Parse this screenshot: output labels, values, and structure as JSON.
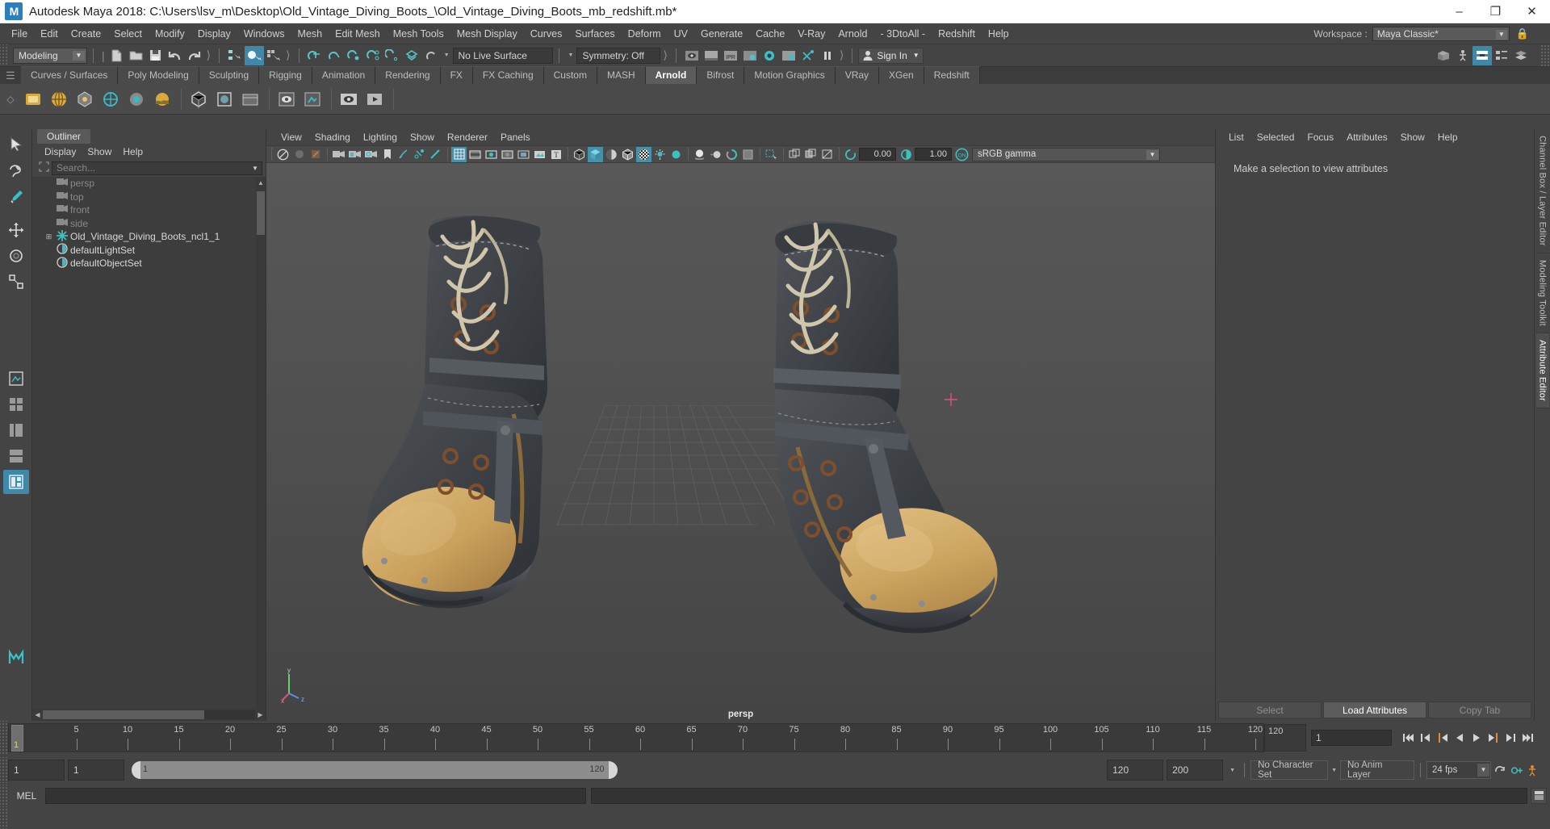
{
  "window": {
    "app_title": "Autodesk Maya 2018: C:\\Users\\lsv_m\\Desktop\\Old_Vintage_Diving_Boots_\\Old_Vintage_Diving_Boots_mb_redshift.mb*",
    "logo_text": "M",
    "minimize": "–",
    "maximize": "❐",
    "close": "✕"
  },
  "menubar": {
    "items": [
      "File",
      "Edit",
      "Create",
      "Select",
      "Modify",
      "Display",
      "Windows",
      "Mesh",
      "Edit Mesh",
      "Mesh Tools",
      "Mesh Display",
      "Curves",
      "Surfaces",
      "Deform",
      "UV",
      "Generate",
      "Cache",
      "V-Ray",
      "Arnold",
      "- 3DtoAll -",
      "Redshift",
      "Help"
    ],
    "workspace_label": "Workspace :",
    "workspace_value": "Maya Classic*",
    "lock_icon": "lock-icon"
  },
  "statusline": {
    "mode": "Modeling",
    "live_surface": "No Live Surface",
    "symmetry": "Symmetry: Off",
    "signin": "Sign In",
    "snap_icons": [
      "new-scene-icon",
      "open-scene-icon",
      "save-scene-icon",
      "undo-icon",
      "redo-icon"
    ],
    "select_mode_icons": [
      "select-by-hierarchy-icon",
      "select-by-object-type-icon",
      "select-by-component-type-icon"
    ],
    "snap_tool_icons": [
      "snap-to-grid-icon",
      "snap-to-curve-icon",
      "snap-to-point-icon",
      "snap-to-projected-center-icon",
      "snap-to-view-plane-icon",
      "make-live-icon"
    ],
    "render_icons": [
      "render-current-frame-icon",
      "ipr-render-icon",
      "ipr-render-frame-icon",
      "render-settings-icon",
      "hypershade-icon",
      "render-view-icon",
      "rendering-flags-icon",
      "pause-icon"
    ],
    "editor_icons": [
      "show-hide-modeling-editor-icon",
      "character-editor-icon",
      "attribute-editor-icon",
      "channel-box-icon",
      "layer-editor-icon"
    ]
  },
  "shelf": {
    "tabs": [
      "Curves / Surfaces",
      "Poly Modeling",
      "Sculpting",
      "Rigging",
      "Animation",
      "Rendering",
      "FX",
      "FX Caching",
      "Custom",
      "MASH",
      "Arnold",
      "Bifrost",
      "Motion Graphics",
      "VRay",
      "XGen",
      "Redshift"
    ],
    "active_tab": "Arnold",
    "icons": [
      "arnold-area-light-icon",
      "arnold-skydome-light-icon",
      "arnold-mesh-light-icon",
      "arnold-photometric-light-icon",
      "arnold-light-portal-icon",
      "arnold-physical-sky-icon",
      "arnold-standin-icon",
      "arnold-volume-icon",
      "arnold-scene-source-icon",
      "arnold-bifrost-icon",
      "arnold-render-icon",
      "arnold-open-render-view-icon",
      "arnold-render-sequence-icon",
      "arnold-flush-caches-icon",
      "arnold-license-icon",
      "arnold-utilities-icon",
      "arnold-play-icon"
    ]
  },
  "toolbox": {
    "items": [
      {
        "name": "select-tool",
        "icon": "➤",
        "selected": false
      },
      {
        "name": "lasso-select-tool",
        "icon": "❀",
        "selected": false
      },
      {
        "name": "paint-select-tool",
        "icon": "✒",
        "selected": false
      },
      {
        "name": "move-tool",
        "icon": "✣",
        "selected": false
      },
      {
        "name": "rotate-tool",
        "icon": "↻",
        "selected": false
      },
      {
        "name": "scale-tool",
        "icon": "▣",
        "selected": false
      },
      {
        "name": "single-perspective-view",
        "icon": "□",
        "selected": false
      },
      {
        "name": "four-view-layout",
        "icon": "⊞",
        "selected": false
      },
      {
        "name": "outliner-persp-layout",
        "icon": "▤",
        "selected": false
      },
      {
        "name": "persp-graph-layout",
        "icon": "▥",
        "selected": false
      },
      {
        "name": "hypershade-persp-layout",
        "icon": "▦",
        "selected": true
      }
    ]
  },
  "outliner": {
    "tab_label": "Outliner",
    "menus": [
      "Display",
      "Show",
      "Help"
    ],
    "search_placeholder": "Search...",
    "search_value": "",
    "items": [
      {
        "label": "persp",
        "icon": "camera-icon",
        "dim": true,
        "expander": ""
      },
      {
        "label": "top",
        "icon": "camera-icon",
        "dim": true,
        "expander": ""
      },
      {
        "label": "front",
        "icon": "camera-icon",
        "dim": true,
        "expander": ""
      },
      {
        "label": "side",
        "icon": "camera-icon",
        "dim": true,
        "expander": ""
      },
      {
        "label": "Old_Vintage_Diving_Boots_ncl1_1",
        "icon": "nucleus-icon",
        "dim": false,
        "expander": "⊞"
      },
      {
        "label": "defaultLightSet",
        "icon": "set-icon",
        "dim": false,
        "expander": ""
      },
      {
        "label": "defaultObjectSet",
        "icon": "set-icon",
        "dim": false,
        "expander": ""
      }
    ]
  },
  "viewport": {
    "menus": [
      "View",
      "Shading",
      "Lighting",
      "Show",
      "Renderer",
      "Panels"
    ],
    "exposure_value": "0.00",
    "gamma_value": "1.00",
    "color_management": "sRGB gamma",
    "camera_label": "persp",
    "axis_labels": {
      "x": "x",
      "y": "y",
      "z": "z"
    },
    "toolbar_icons": [
      "select-camera-icon",
      "lock-camera-icon",
      "camera-attributes-icon",
      "bookmark-icon",
      "image-plane-icon",
      "two-sided-lighting-icon",
      "shadows-icon",
      "grid-toggle-icon",
      "film-gate-icon",
      "resolution-gate-icon",
      "gate-mask-icon",
      "xray-joints-icon",
      "texture-icon",
      "text-icon",
      "wireframe-icon",
      "smooth-shade-all-icon",
      "shade-flat-icon",
      "wireframe-on-shaded-icon",
      "textured-icon",
      "use-all-lights-icon",
      "shadow-icon",
      "ao-icon",
      "motion-blur-icon",
      "multisample-icon",
      "isolate-select-icon",
      "xray-icon",
      "xray-active-components-icon",
      "exposure-icon",
      "gamma-icon",
      "color-management-icon"
    ]
  },
  "attribute_editor": {
    "menus": [
      "List",
      "Selected",
      "Focus",
      "Attributes",
      "Show",
      "Help"
    ],
    "empty_message": "Make a selection to view attributes",
    "buttons": [
      {
        "label": "Select",
        "active": false
      },
      {
        "label": "Load Attributes",
        "active": true
      },
      {
        "label": "Copy Tab",
        "active": false
      }
    ]
  },
  "right_tabs": [
    {
      "label": "Channel Box / Layer Editor",
      "selected": false
    },
    {
      "label": "Modeling Toolkit",
      "selected": false
    },
    {
      "label": "Attribute Editor",
      "selected": true
    }
  ],
  "timeline": {
    "current_frame": "1",
    "end_display": "120",
    "tick_labels": [
      5,
      10,
      15,
      20,
      25,
      30,
      35,
      40,
      45,
      50,
      55,
      60,
      65,
      70,
      75,
      80,
      85,
      90,
      95,
      100,
      105,
      110,
      115,
      120
    ],
    "key_field_value": "1",
    "playback_buttons": [
      "go-to-start-icon",
      "step-back-keyframe-icon",
      "step-back-frame-icon",
      "play-backwards-icon",
      "play-forwards-icon",
      "step-forward-frame-icon",
      "step-forward-keyframe-icon",
      "go-to-end-icon"
    ]
  },
  "range": {
    "anim_start": "1",
    "playback_start": "1",
    "bar_start_label": "1",
    "bar_end_label": "120",
    "playback_end": "120",
    "anim_end": "200",
    "character_set": "No Character Set",
    "anim_layer": "No Anim Layer",
    "fps": "24 fps",
    "auto_key_icon": "auto-keyframe-icon",
    "anim_pref_icon": "animation-preferences-icon",
    "cycle_icon": "cycle-icon"
  },
  "command_line": {
    "language_label": "MEL",
    "input_value": "",
    "output_value": "",
    "script_editor_icon": "script-editor-icon"
  },
  "colors": {
    "accent": "#4a8fa8",
    "panel_bg": "#444444",
    "field_bg": "#333333",
    "highlight": "#3f88a8",
    "title_bar": "#ffffff",
    "timeline_key": "#e4cf6a"
  }
}
